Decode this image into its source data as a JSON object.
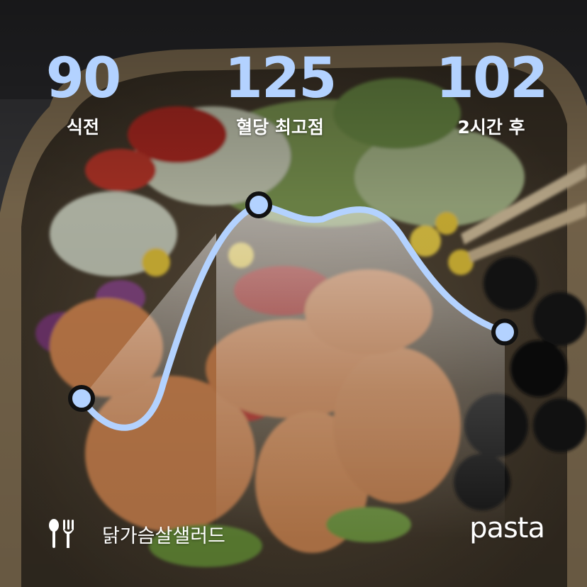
{
  "colors": {
    "accent": "#b3d2ff",
    "curve": "#b3d2ff",
    "marker_outline": "#111111",
    "label": "#ffffff"
  },
  "stats": {
    "before": {
      "value": "90",
      "label": "식전"
    },
    "peak": {
      "value": "125",
      "label": "혈당 최고점"
    },
    "after": {
      "value": "102",
      "label": "2시간 후"
    }
  },
  "glucose_curve": {
    "points": [
      90,
      125,
      102
    ]
  },
  "meal": {
    "icon": "utensils-icon",
    "name": "닭가슴살샐러드"
  },
  "brand": {
    "logo_text": "pasta"
  }
}
